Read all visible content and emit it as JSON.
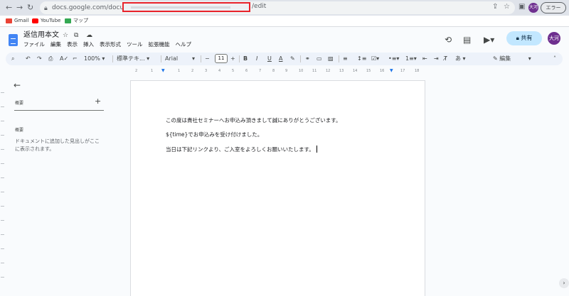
{
  "browser": {
    "back_icon": "arrow-left-icon",
    "forward_icon": "arrow-right-icon",
    "reload_icon": "reload-icon",
    "url_prefix": "docs.google.com/document/d/",
    "url_suffix": "/edit",
    "profile_initials": "大河",
    "error_label": "エラー"
  },
  "bookmarks": [
    {
      "label": "Gmail",
      "color": "#ea4335"
    },
    {
      "label": "YouTube",
      "color": "#ff0000"
    },
    {
      "label": "マップ",
      "color": "#34a853"
    }
  ],
  "doc": {
    "title": "返信用本文",
    "menus": [
      "ファイル",
      "編集",
      "表示",
      "挿入",
      "表示形式",
      "ツール",
      "拡張機能",
      "ヘルプ"
    ],
    "share_label": "共有",
    "avatar_initials": "大河"
  },
  "toolbar": {
    "zoom": "100%",
    "style": "標準テキ...",
    "font": "Arial",
    "font_size": "11",
    "mode_label": "編集",
    "bold": "B",
    "italic": "I",
    "underline": "U",
    "language": "あ"
  },
  "ruler": {
    "numbers": [
      "2",
      "1",
      "1",
      "2",
      "3",
      "4",
      "5",
      "6",
      "7",
      "8",
      "9",
      "10",
      "11",
      "12",
      "13",
      "14",
      "15",
      "16",
      "17",
      "18"
    ]
  },
  "outline": {
    "summary_label": "概要",
    "headings_label": "概要",
    "hint": "ドキュメントに追加した見出しがここに表示されます。"
  },
  "body": {
    "paragraphs": [
      "この度は貴社セミナーへお申込み頂きまして誠にありがとうございます。",
      "${time}でお申込みを受け付けました。",
      "当日は下記リンクより、ご入室をよろしくお願いいたします。"
    ]
  },
  "colors": {
    "accent": "#1a73e8",
    "share_bg": "#c2e7ff",
    "avatar": "#6e2f8f",
    "redaction": "#e8232b"
  }
}
